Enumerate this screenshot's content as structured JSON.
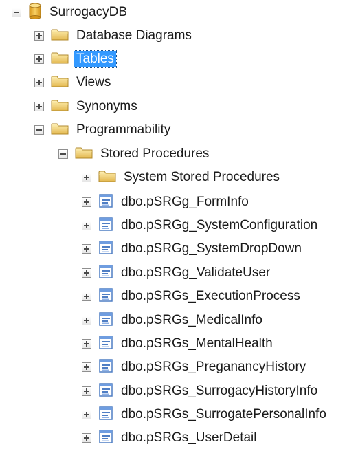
{
  "tree": {
    "root": {
      "label": "SurrogacyDB",
      "icon": "database-icon",
      "state": "expanded"
    },
    "database_diagrams": {
      "label": "Database Diagrams",
      "icon": "folder-icon",
      "state": "collapsed"
    },
    "tables": {
      "label": "Tables",
      "icon": "folder-icon",
      "state": "collapsed",
      "selected": true
    },
    "views": {
      "label": "Views",
      "icon": "folder-icon",
      "state": "collapsed"
    },
    "synonyms": {
      "label": "Synonyms",
      "icon": "folder-icon",
      "state": "collapsed"
    },
    "programmability": {
      "label": "Programmability",
      "icon": "folder-icon",
      "state": "expanded"
    },
    "stored_procedures": {
      "label": "Stored Procedures",
      "icon": "folder-icon",
      "state": "expanded"
    },
    "system_stored_procedures": {
      "label": "System Stored Procedures",
      "icon": "folder-icon",
      "state": "collapsed"
    },
    "procedures": [
      {
        "label": "dbo.pSRGg_FormInfo",
        "icon": "stored-procedure-icon"
      },
      {
        "label": "dbo.pSRGg_SystemConfiguration",
        "icon": "stored-procedure-icon"
      },
      {
        "label": "dbo.pSRGg_SystemDropDown",
        "icon": "stored-procedure-icon"
      },
      {
        "label": "dbo.pSRGg_ValidateUser",
        "icon": "stored-procedure-icon"
      },
      {
        "label": "dbo.pSRGs_ExecutionProcess",
        "icon": "stored-procedure-icon"
      },
      {
        "label": "dbo.pSRGs_MedicalInfo",
        "icon": "stored-procedure-icon"
      },
      {
        "label": "dbo.pSRGs_MentalHealth",
        "icon": "stored-procedure-icon"
      },
      {
        "label": "dbo.pSRGs_PreganancyHistory",
        "icon": "stored-procedure-icon"
      },
      {
        "label": "dbo.pSRGs_SurrogacyHistoryInfo",
        "icon": "stored-procedure-icon"
      },
      {
        "label": "dbo.pSRGs_SurrogatePersonalInfo",
        "icon": "stored-procedure-icon"
      },
      {
        "label": "dbo.pSRGs_UserDetail",
        "icon": "stored-procedure-icon"
      }
    ]
  },
  "colors": {
    "selection": "#3399ff",
    "folder": "#e8c15a",
    "database": "#e7b33c",
    "procedure": "#4f7ec4"
  }
}
